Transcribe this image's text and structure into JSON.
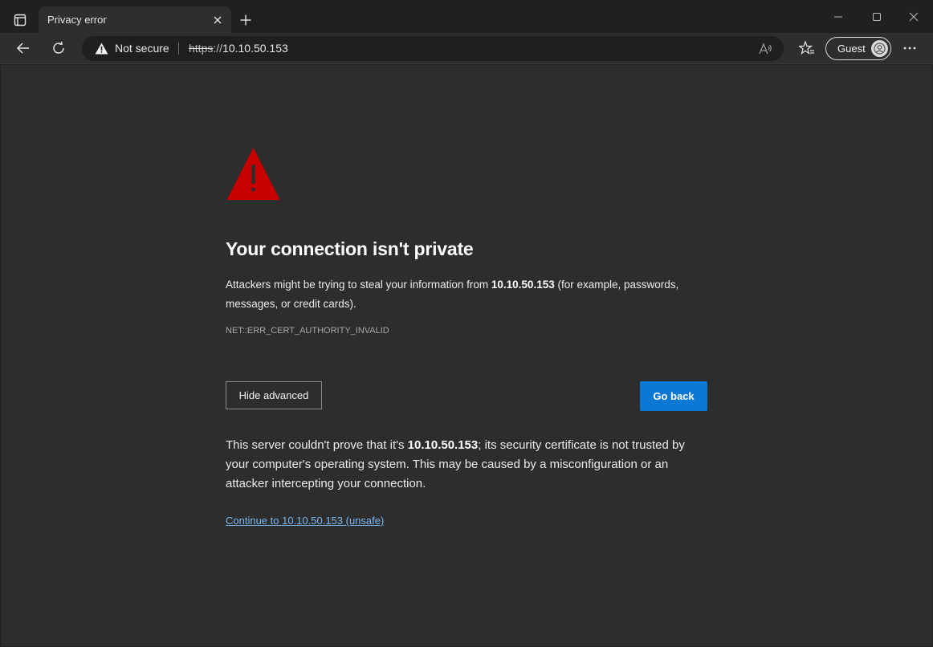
{
  "tab": {
    "title": "Privacy error"
  },
  "toolbar": {
    "security_label": "Not secure",
    "url_scheme": "https",
    "url_sep": "://",
    "url_host": "10.10.50.153",
    "guest_label": "Guest"
  },
  "page": {
    "title": "Your connection isn't private",
    "desc_part1": "Attackers might be trying to steal your information from ",
    "desc_host": "10.10.50.153",
    "desc_part2": " (for example, passwords, messages, or credit cards).",
    "error_code": "NET::ERR_CERT_AUTHORITY_INVALID",
    "hide_advanced_label": "Hide advanced",
    "go_back_label": "Go back",
    "details_part1": "This server couldn't prove that it's ",
    "details_host": "10.10.50.153",
    "details_part2": "; its security certificate is not trusted by your computer's operating system. This may be caused by a misconfiguration or an attacker intercepting your connection.",
    "proceed_link": "Continue to 10.10.50.153 (unsafe)"
  },
  "icons": {
    "tab_actions": "tab-actions-icon",
    "close": "close-icon",
    "new_tab": "plus-icon",
    "minimize": "minimize-icon",
    "maximize": "maximize-icon",
    "window_close": "window-close-icon",
    "back": "back-arrow-icon",
    "reload": "reload-icon",
    "warning": "warning-icon",
    "read_aloud": "read-aloud-icon",
    "favorites": "favorites-icon",
    "avatar": "guest-avatar-icon",
    "more": "more-icon",
    "page_warning": "warning-triangle-icon"
  },
  "colors": {
    "accent_button": "#0a78d4",
    "warning_red": "#c80000",
    "link": "#78b7f0",
    "page_bg": "#2d2d2d"
  }
}
